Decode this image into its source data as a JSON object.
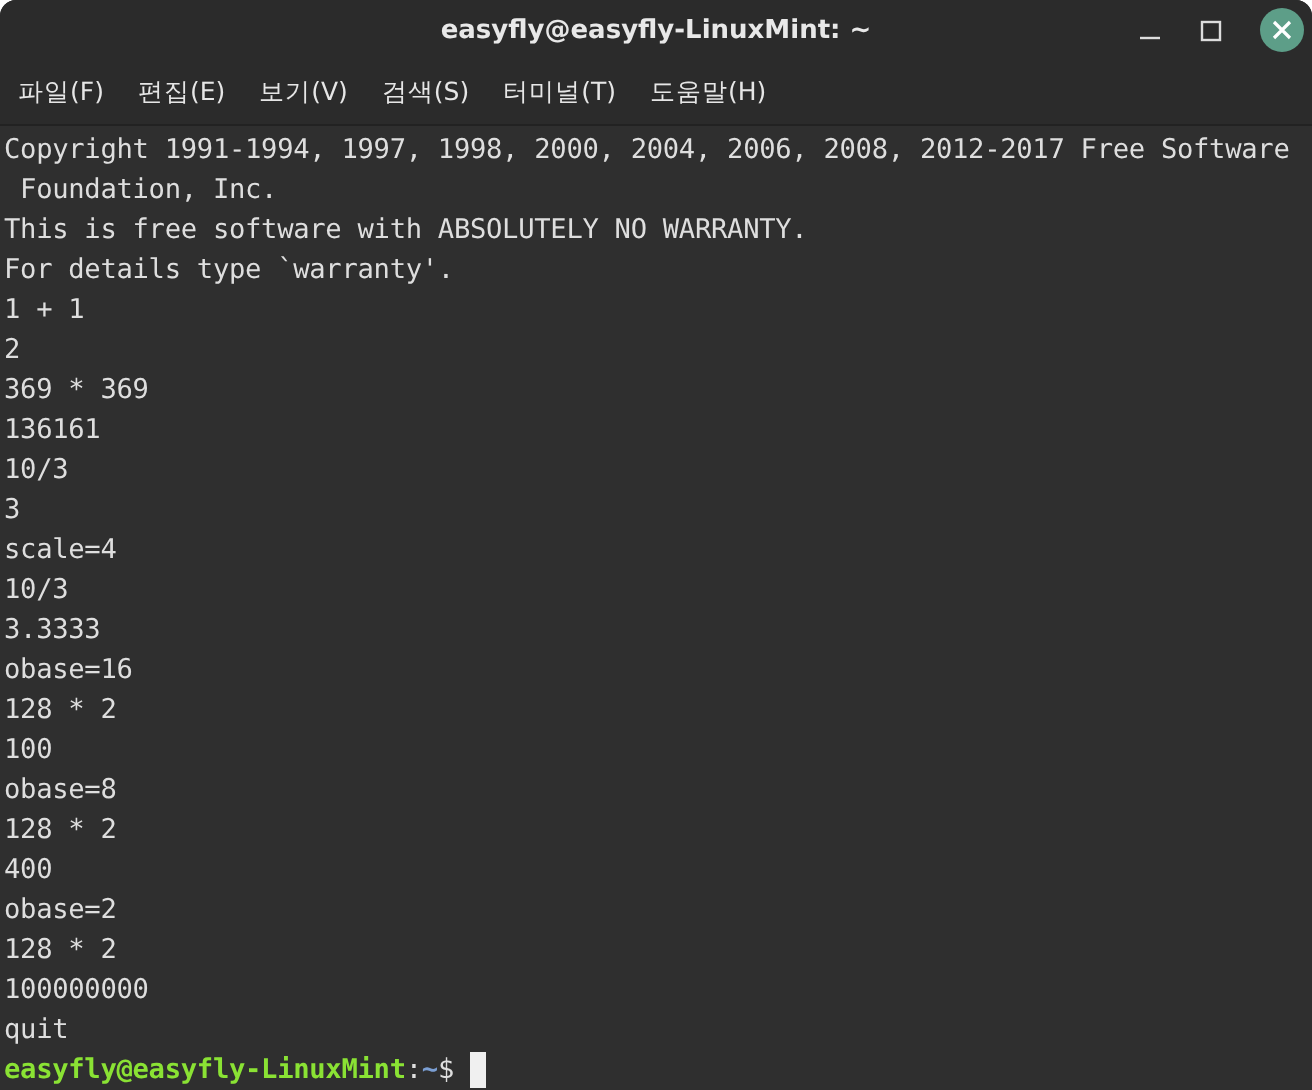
{
  "window": {
    "title": "easyfly@easyfly-LinuxMint: ~"
  },
  "menu": [
    {
      "label": "파일(F)"
    },
    {
      "label": "편집(E)"
    },
    {
      "label": "보기(V)"
    },
    {
      "label": "검색(S)"
    },
    {
      "label": "터미널(T)"
    },
    {
      "label": "도움말(H)"
    }
  ],
  "terminal": {
    "lines": [
      "Copyright 1991-1994, 1997, 1998, 2000, 2004, 2006, 2008, 2012-2017 Free Software",
      " Foundation, Inc.",
      "This is free software with ABSOLUTELY NO WARRANTY.",
      "For details type `warranty'.",
      "1 + 1",
      "2",
      "369 * 369",
      "136161",
      "10/3",
      "3",
      "scale=4",
      "10/3",
      "3.3333",
      "obase=16",
      "128 * 2",
      "100",
      "obase=8",
      "128 * 2",
      "400",
      "obase=2",
      "128 * 2",
      "100000000",
      "quit"
    ],
    "prompt": {
      "user_host": "easyfly@easyfly-LinuxMint",
      "separator": ":",
      "path": "~",
      "symbol": "$"
    }
  }
}
